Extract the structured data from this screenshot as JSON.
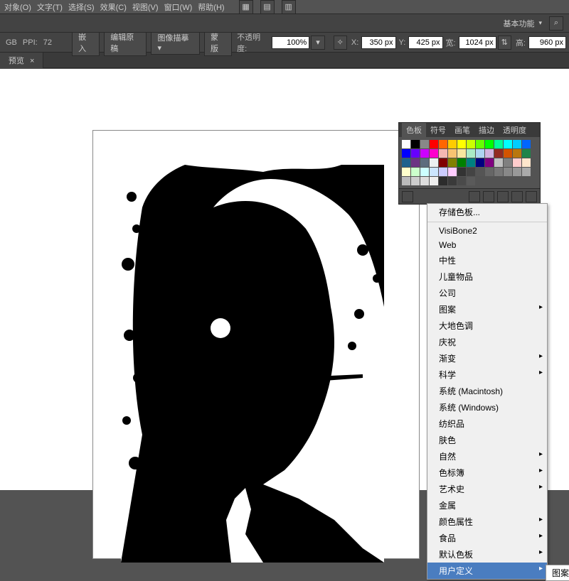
{
  "menu": [
    "对象(O)",
    "文字(T)",
    "选择(S)",
    "效果(C)",
    "视图(V)",
    "窗口(W)",
    "帮助(H)"
  ],
  "basic_func": "基本功能",
  "row1": {
    "gb": "GB",
    "ppi_lbl": "PPI:",
    "ppi": "72"
  },
  "ctrl": {
    "embed": "嵌入",
    "editorigin": "编辑原稿",
    "imgtrace": "图像描摹",
    "mask": "蒙版",
    "opacity_lbl": "不透明度:",
    "opacity": "100%",
    "x_lbl": "X:",
    "x": "350 px",
    "y_lbl": "Y:",
    "y": "425 px",
    "w_lbl": "宽:",
    "w": "1024 px",
    "h_lbl": "高:",
    "h": "960 px"
  },
  "tab": {
    "name": "预览",
    "close": "×"
  },
  "panel": {
    "tabs": [
      "色板",
      "符号",
      "画笔",
      "描边",
      "透明度"
    ]
  },
  "swatches": [
    "#fff",
    "#000",
    "#888",
    "#ff0000",
    "#ff6600",
    "#ffcc00",
    "#ffff00",
    "#ccff00",
    "#66ff00",
    "#00ff00",
    "#00ff99",
    "#00ffff",
    "#00ccff",
    "#0066ff",
    "#0000ff",
    "#6600ff",
    "#cc00ff",
    "#ff00cc",
    "#f5b7b1",
    "#f8c471",
    "#f9e79f",
    "#abebc6",
    "#aed6f1",
    "#d2b4de",
    "#922b21",
    "#d35400",
    "#b9770e",
    "#1e8449",
    "#1f618d",
    "#6c3483",
    "#5d6d7e",
    "#ecf0f1",
    "#800000",
    "#808000",
    "#008000",
    "#008080",
    "#000080",
    "#800080",
    "#c0c0c0",
    "#808080",
    "#ffcccc",
    "#ffe6cc",
    "#ffffcc",
    "#ccffcc",
    "#ccffff",
    "#cce6ff",
    "#ccccff",
    "#ffccff",
    "#333",
    "#444",
    "#555",
    "#666",
    "#777",
    "#888",
    "#999",
    "#aaa",
    "#bbb",
    "#ccc",
    "#ddd",
    "#eee",
    "#2c2c2c",
    "#3a3a3a",
    "#4a4a4a",
    "#5a5a5a"
  ],
  "menu_items": [
    {
      "t": "存储色板...",
      "a": false
    },
    {
      "hr": true
    },
    {
      "t": "VisiBone2",
      "a": false
    },
    {
      "t": "Web",
      "a": false
    },
    {
      "t": "中性",
      "a": false
    },
    {
      "t": "儿童物品",
      "a": false
    },
    {
      "t": "公司",
      "a": false
    },
    {
      "t": "图案",
      "a": true
    },
    {
      "t": "大地色调",
      "a": false
    },
    {
      "t": "庆祝",
      "a": false
    },
    {
      "t": "渐变",
      "a": true
    },
    {
      "t": "科学",
      "a": true
    },
    {
      "t": "系统 (Macintosh)",
      "a": false
    },
    {
      "t": "系统 (Windows)",
      "a": false
    },
    {
      "t": "纺织品",
      "a": false
    },
    {
      "t": "肤色",
      "a": false
    },
    {
      "t": "自然",
      "a": true
    },
    {
      "t": "色标簿",
      "a": true
    },
    {
      "t": "艺术史",
      "a": true
    },
    {
      "t": "金属",
      "a": false
    },
    {
      "t": "颜色属性",
      "a": true
    },
    {
      "t": "食品",
      "a": true
    },
    {
      "t": "默认色板",
      "a": true
    },
    {
      "t": "用户定义",
      "a": true,
      "hl": true
    }
  ],
  "flyout": "图案"
}
